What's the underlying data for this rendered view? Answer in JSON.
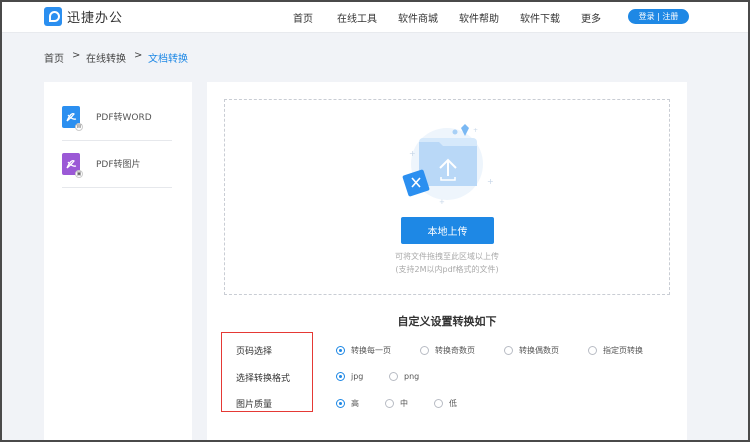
{
  "header": {
    "brand": "迅捷办公",
    "nav": [
      "首页",
      "在线工具",
      "软件商城",
      "软件帮助",
      "软件下载",
      "更多"
    ],
    "login": "登录 | 注册"
  },
  "breadcrumb": [
    "首页",
    ">",
    "在线转换",
    ">",
    "文档转换"
  ],
  "sidebar": {
    "items": [
      {
        "label": "PDF转WORD",
        "badge": "W"
      },
      {
        "label": "PDF转图片",
        "badge": "▣"
      }
    ]
  },
  "upload": {
    "button": "本地上传",
    "hint1": "可将文件拖拽至此区域以上传",
    "hint2": "(支持2M以内pdf格式的文件)"
  },
  "settings": {
    "title": "自定义设置转换如下",
    "rows": [
      {
        "label": "页码选择",
        "options": [
          "转换每一页",
          "转换奇数页",
          "转换偶数页",
          "指定页转换"
        ],
        "selected": 0
      },
      {
        "label": "选择转换格式",
        "options": [
          "jpg",
          "png"
        ],
        "selected": 0
      },
      {
        "label": "图片质量",
        "options": [
          "高",
          "中",
          "低"
        ],
        "selected": 0
      }
    ]
  },
  "colors": {
    "accent": "#1e88e5",
    "highlight_box": "#e53935"
  }
}
